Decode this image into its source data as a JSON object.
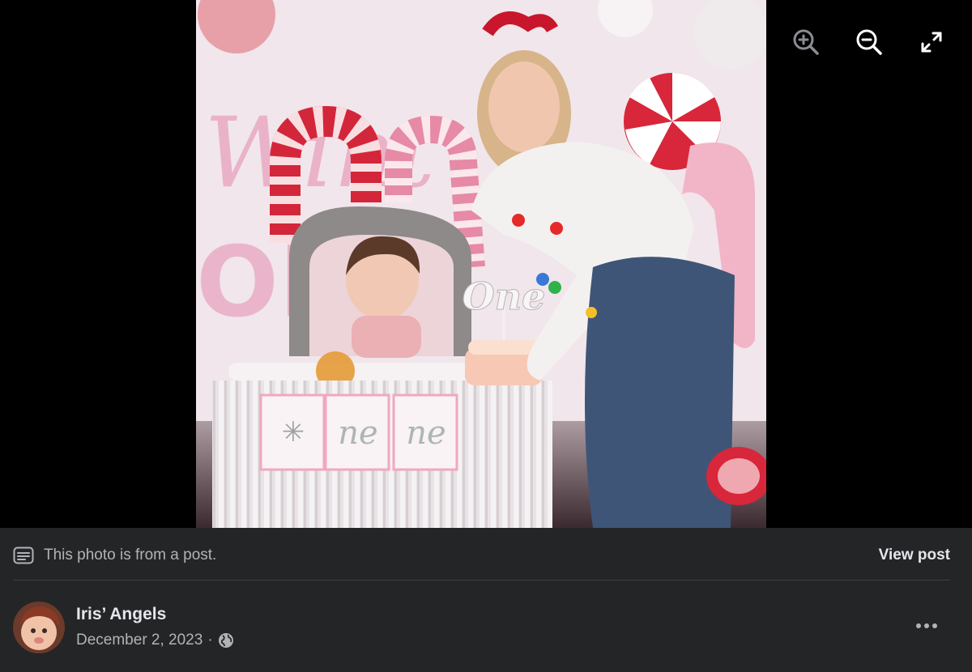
{
  "viewer": {
    "controls": {
      "zoom_in_icon": "zoom-in-icon",
      "zoom_out_icon": "zoom-out-icon",
      "fullscreen_icon": "fullscreen-icon"
    }
  },
  "photo": {
    "topper_text": "One",
    "banner_letters": [
      "",
      "ne",
      "ne"
    ]
  },
  "post_info": {
    "note_icon": "post-note-icon",
    "note": "This photo is from a post.",
    "view_post": "View post",
    "author": "Iris’ Angels",
    "date": "December 2, 2023",
    "separator": "·",
    "audience_icon": "globe-icon",
    "more_icon": "more-options-icon"
  },
  "colors": {
    "background": "#000000",
    "panel": "#242526",
    "primary_text": "#e4e6eb",
    "secondary_text": "#b0b3b8",
    "divider": "#3e4042"
  }
}
